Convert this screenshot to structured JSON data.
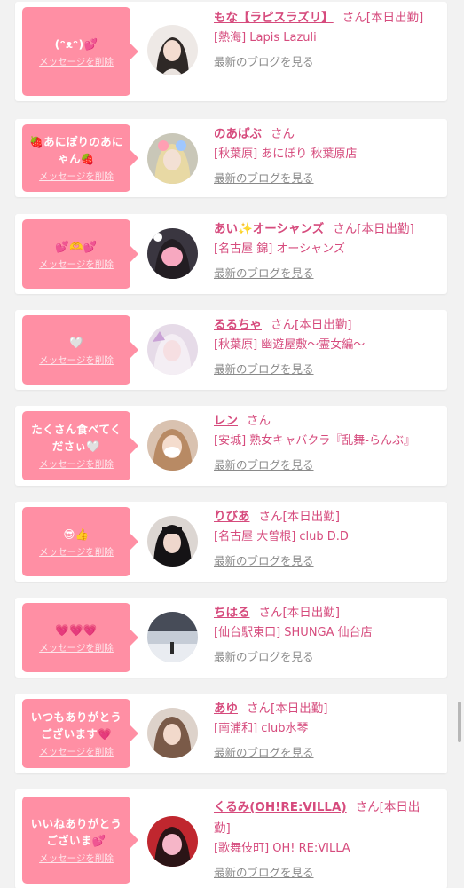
{
  "delete_label": "メッセージを削除",
  "blog_label": "最新のブログを見る",
  "accent": "#ff8fa4",
  "link_color": "#d64b7d",
  "items": [
    {
      "message": "(ᵔᴥᵔ)💕",
      "name": "もな【ラピスラズリ】",
      "suffix": "さん[本日出勤]",
      "shop": "[熱海] Lapis Lazuli"
    },
    {
      "message": "🍓あにぽりのあにゃん🍓",
      "name": "のあぱぶ",
      "suffix": "さん",
      "shop": "[秋葉原] あにぽり 秋葉原店"
    },
    {
      "message": "💕🫶💕",
      "name": "あい✨オーシャンズ",
      "suffix": "さん[本日出勤]",
      "shop": "[名古屋 錦] オーシャンズ"
    },
    {
      "message": "🤍",
      "name": "るるちゃ",
      "suffix": "さん[本日出勤]",
      "shop": "[秋葉原] 幽遊屋敷〜霊女編〜"
    },
    {
      "message": "たくさん食べてくださぃ🤍",
      "name": "レン",
      "suffix": "さん",
      "shop": "[安城] 熟女キャバクラ『乱舞-らんぶ』"
    },
    {
      "message": "😎👍",
      "name": "りびあ",
      "suffix": "さん[本日出勤]",
      "shop": "[名古屋 大曽根] club D.D"
    },
    {
      "message": "💗💗💗",
      "name": "ちはる",
      "suffix": "さん[本日出勤]",
      "shop": "[仙台駅東口] SHUNGA 仙台店"
    },
    {
      "message": "いつもありがとうございます💗",
      "name": "あゆ",
      "suffix": "さん[本日出勤]",
      "shop": "[南浦和] club水琴"
    },
    {
      "message": "いいねありがとうございま💕",
      "name": "くるみ(OH!RE:VILLA)",
      "suffix": "さん[本日出勤]",
      "shop": "[歌舞伎町] OH! RE:VILLA"
    }
  ]
}
